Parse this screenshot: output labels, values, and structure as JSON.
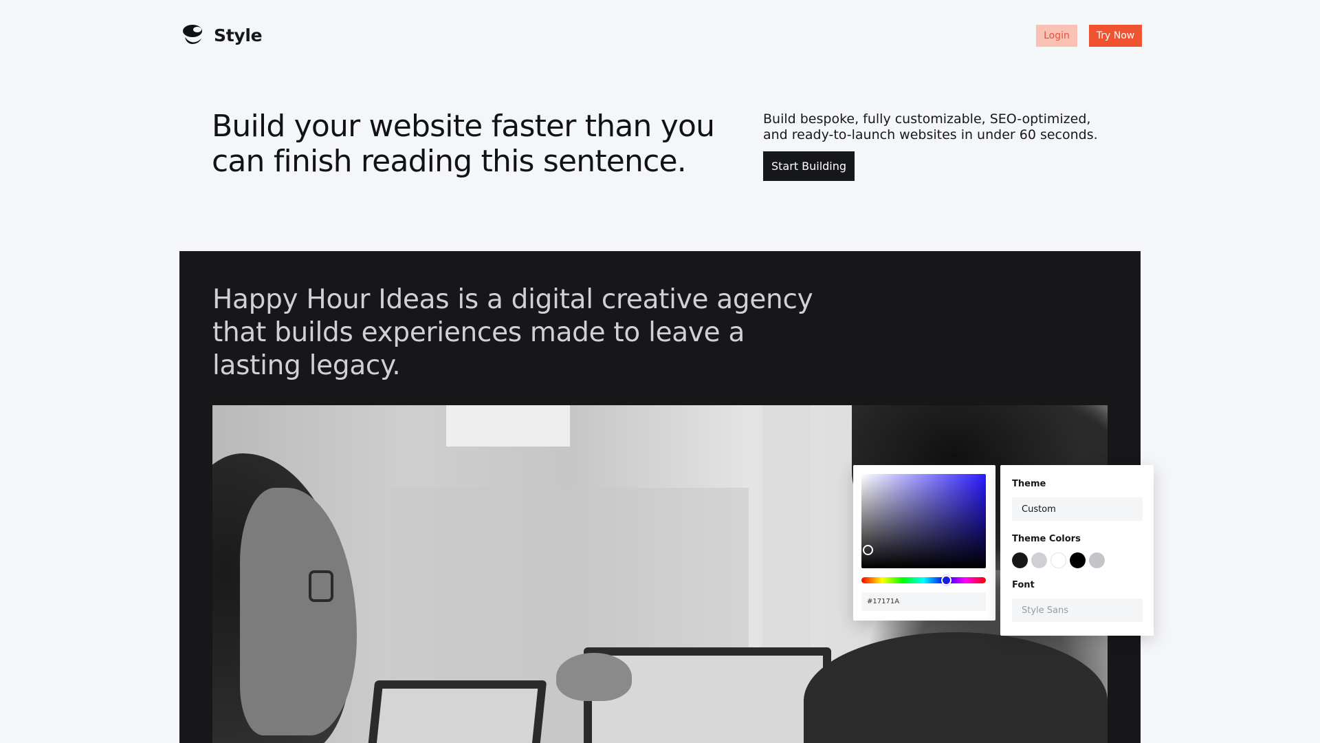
{
  "brand": {
    "name": "Style"
  },
  "nav": {
    "login_label": "Login",
    "try_label": "Try Now"
  },
  "hero": {
    "title": "Build your website faster than you can finish reading this sentence.",
    "description": "Build bespoke, fully customizable, SEO-optimized, and ready-to-launch websites in under 60 seconds.",
    "cta_label": "Start Building"
  },
  "preview": {
    "headline": "Happy Hour Ideas is a digital creative agency that builds experiences made to leave a lasting legacy."
  },
  "color_picker": {
    "hex_value": "#17171A"
  },
  "theme_panel": {
    "theme_label": "Theme",
    "theme_value": "Custom",
    "colors_label": "Theme Colors",
    "colors": [
      "#17171a",
      "#cfd0d3",
      "#ffffff",
      "#000000",
      "#c4c5c8"
    ],
    "font_label": "Font",
    "font_value": "Style Sans"
  },
  "icons": {
    "logo": "style-logo-icon"
  }
}
